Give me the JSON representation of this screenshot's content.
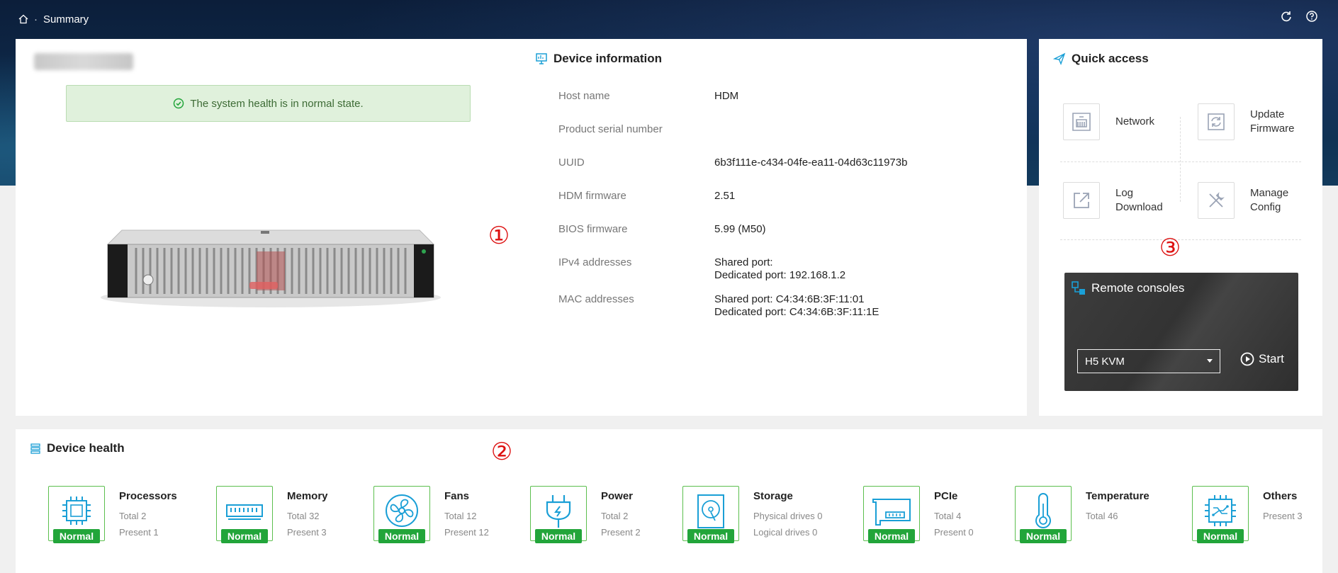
{
  "breadcrumb": {
    "current": "Summary",
    "separator": "·"
  },
  "header_icons": [
    "home-icon",
    "refresh-icon",
    "help-icon"
  ],
  "summary": {
    "health_message": "The system health is in normal state."
  },
  "device_info": {
    "title": "Device information",
    "rows": [
      {
        "label": "Host name",
        "value": "HDM"
      },
      {
        "label": "Product serial number",
        "value": ""
      },
      {
        "label": "UUID",
        "value": "6b3f111e-c434-04fe-ea11-04d63c11973b"
      },
      {
        "label": "HDM firmware",
        "value": "2.51"
      },
      {
        "label": "BIOS firmware",
        "value": "5.99 (M50)"
      },
      {
        "label": "IPv4 addresses",
        "value": "Shared port:",
        "value2": "Dedicated port: 192.168.1.2"
      },
      {
        "label": "MAC addresses",
        "value": "Shared port: C4:34:6B:3F:11:01",
        "value2": "Dedicated port: C4:34:6B:3F:11:1E"
      }
    ]
  },
  "quick_access": {
    "title": "Quick access",
    "items": [
      {
        "label": "Network",
        "icon": "network-icon"
      },
      {
        "label": "Update Firmware",
        "icon": "update-firmware-icon"
      },
      {
        "label": "Log Download",
        "icon": "log-download-icon"
      },
      {
        "label": "Manage Config",
        "icon": "manage-config-icon"
      }
    ]
  },
  "remote_consoles": {
    "title": "Remote consoles",
    "selected": "H5 KVM",
    "start_label": "Start"
  },
  "device_health": {
    "title": "Device health",
    "items": [
      {
        "name": "Processors",
        "line1": "Total 2",
        "line2": "Present 1",
        "status": "Normal"
      },
      {
        "name": "Memory",
        "line1": "Total 32",
        "line2": "Present 3",
        "status": "Normal"
      },
      {
        "name": "Fans",
        "line1": "Total 12",
        "line2": "Present 12",
        "status": "Normal"
      },
      {
        "name": "Power",
        "line1": "Total 2",
        "line2": "Present 2",
        "status": "Normal"
      },
      {
        "name": "Storage",
        "line1": "Physical drives 0",
        "line2": "Logical drives 0",
        "status": "Normal"
      },
      {
        "name": "PCIe",
        "line1": "Total 4",
        "line2": "Present 0",
        "status": "Normal"
      },
      {
        "name": "Temperature",
        "line1": "Total 46",
        "line2": "",
        "status": "Normal"
      },
      {
        "name": "Others",
        "line1": "Present 3",
        "line2": "",
        "status": "Normal"
      }
    ]
  },
  "markers": [
    "①",
    "②",
    "③"
  ],
  "colors": {
    "accent": "#1a9fd6",
    "normal": "#22a53a",
    "health_banner": "#e0f1dc"
  }
}
